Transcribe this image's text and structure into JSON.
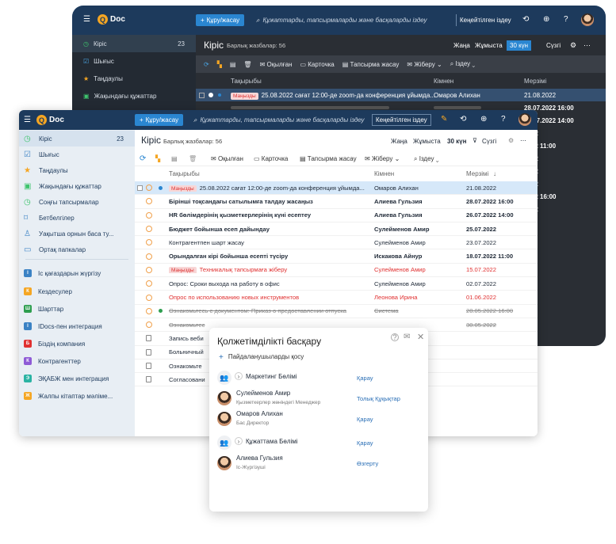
{
  "dark": {
    "logo": "Doc",
    "create": "Құру/жасау",
    "search_placeholder": "Құжаттарды, тапсырмаларды және басқаларды іздеу",
    "advanced": "Кеңейтілген іздеу",
    "sidebar": [
      {
        "label": "Кіріс",
        "count": "23",
        "icon": "clock-icon"
      },
      {
        "label": "Шығыс",
        "icon": "check-box-icon"
      },
      {
        "label": "Таңдаулы",
        "icon": "star-icon"
      },
      {
        "label": "Жақындағы құжаттар",
        "icon": "document-icon"
      }
    ],
    "title": "Кіріс",
    "subtitle": "Барлық жазбалар: 56",
    "filters": [
      "Жаңа",
      "Жұмыста",
      "30 күн",
      "Сүзгі"
    ],
    "toolbar": [
      "Оқылған",
      "Карточка",
      "Тапсырма жасау",
      "Жіберу",
      "Іздеу"
    ],
    "columns": [
      "Тақырыбы",
      "Кімнен",
      "Мерзімі"
    ],
    "rows": [
      {
        "tag": "Маңызды",
        "title": "25.08.2022 сағат 12:00-де zoom-да конференция ұйымда...",
        "from": "Омаров Алихан",
        "date": "21.08.2022"
      },
      {
        "tag": "",
        "title": "",
        "from": "",
        "date": "28.07.2022 16:00"
      },
      {
        "tag": "",
        "title": "",
        "from": "",
        "date": "26.07.2022 14:00"
      },
      {
        "tag": "",
        "title": "",
        "from": "",
        "date": "2022"
      },
      {
        "tag": "",
        "title": "",
        "from": "",
        "date": "2022 11:00"
      },
      {
        "tag": "",
        "title": "",
        "from": "",
        "date": "2022"
      },
      {
        "tag": "",
        "title": "",
        "from": "",
        "date": "2022"
      },
      {
        "tag": "",
        "title": "",
        "from": "",
        "date": "2022"
      },
      {
        "tag": "",
        "title": "",
        "from": "",
        "date": "2022 16:00"
      },
      {
        "tag": "",
        "title": "",
        "from": "",
        "date": "2022"
      }
    ]
  },
  "light": {
    "logo": "Doc",
    "create": "Құру/жасау",
    "search_placeholder": "Құжаттарды, тапсырмаларды және басқаларды іздеу",
    "advanced": "Кеңейтілген іздеу",
    "sidebar": [
      {
        "label": "Кіріс",
        "count": "23",
        "icon": "clock-icon"
      },
      {
        "label": "Шығыс",
        "icon": "check-box-icon"
      },
      {
        "label": "Таңдаулы",
        "icon": "star-icon"
      },
      {
        "label": "Жақындағы құжаттар",
        "icon": "document-icon"
      },
      {
        "label": "Соңғы тапсырмалар",
        "icon": "clock-icon"
      },
      {
        "label": "Бетбелгілер",
        "icon": "bookmark-icon"
      },
      {
        "label": "Уақытша орнын баса ту...",
        "icon": "user-icon"
      },
      {
        "label": "Ортақ папкалар",
        "icon": "folder-icon"
      },
      {
        "label": "Іс қағаздарын жүргізу",
        "letter": "І",
        "color": "#3b82c4"
      },
      {
        "label": "Кездесулер",
        "letter": "К",
        "color": "#f5a623"
      },
      {
        "label": "Шарттар",
        "letter": "Ш",
        "color": "#2e9e4f"
      },
      {
        "label": "IDocs-пен интеграция",
        "letter": "І",
        "color": "#3b82c4"
      },
      {
        "label": "Біздің компания",
        "letter": "Б",
        "color": "#e03131"
      },
      {
        "label": "Контрагенттер",
        "letter": "К",
        "color": "#8e5bd6"
      },
      {
        "label": "ЭҚАБЖ мен интеграция",
        "letter": "Э",
        "color": "#2bb3a3"
      },
      {
        "label": "Жалпы кітаптар мәліме...",
        "letter": "Ж",
        "color": "#f5a623"
      }
    ],
    "title": "Кіріс",
    "subtitle": "Барлық жазбалар: 56",
    "filters": [
      "Жаңа",
      "Жұмыста",
      "30 күн",
      "Сүзгі"
    ],
    "toolbar": [
      "Оқылған",
      "Карточка",
      "Тапсырма жасау",
      "Жіберу",
      "Іздеу"
    ],
    "columns": [
      "Тақырыбы",
      "Кімнен",
      "Мерзімі"
    ],
    "rows": [
      {
        "tag": "Маңызды",
        "title": "25.08.2022 сағат 12:00-де zoom-да конференция ұйымда...",
        "from": "Омаров Алихан",
        "date": "21.08.2022",
        "style": "sel",
        "icon": "clock"
      },
      {
        "tag": "",
        "title": "Бірінші тоқсандағы сатылымға талдау жасаңыз",
        "from": "Алиева Гульзия",
        "date": "28.07.2022 16:00",
        "style": "bold",
        "icon": "clock"
      },
      {
        "tag": "",
        "title": "HR бөлімдерінің қызметкерлерінің күні есептеу",
        "from": "Алиева Гульзия",
        "date": "26.07.2022 14:00",
        "style": "bold",
        "icon": "clock"
      },
      {
        "tag": "",
        "title": "Бюджет бойынша есеп дайындау",
        "from": "Сулейменов Амир",
        "date": "25.07.2022",
        "style": "bold",
        "icon": "clock"
      },
      {
        "tag": "",
        "title": "Контрагентпен шарт жасау",
        "from": "Сулейменов Амир",
        "date": "23.07.2022",
        "style": "",
        "icon": "clock"
      },
      {
        "tag": "",
        "title": "Орындалған кірі бойынша есепті түсіру",
        "from": "Искакова Айнур",
        "date": "18.07.2022 11:00",
        "style": "bold",
        "icon": "clock"
      },
      {
        "tag": "Маңызды",
        "title": "Техникалық тапсырмаға жіберу",
        "from": "Сулейменов Амир",
        "date": "15.07.2022",
        "style": "red",
        "icon": "clock"
      },
      {
        "tag": "",
        "title": "Опрос: Сроки выхода на работу в офис",
        "from": "Сулейменов Амир",
        "date": "02.07.2022",
        "style": "",
        "icon": "clock"
      },
      {
        "tag": "",
        "title": "Опрос по использованию новых инструментов",
        "from": "Леонова Ирина",
        "date": "01.06.2022",
        "style": "red",
        "icon": "clock"
      },
      {
        "tag": "",
        "title": "Ознакомьтесь с документом: Приказ о предоставлении отпуска",
        "from": "Система",
        "date": "28.05.2022 16:00",
        "style": "strike",
        "icon": "clock"
      },
      {
        "tag": "",
        "title": "Ознакомьтес",
        "from": "",
        "date": "30.05.2022",
        "style": "strike",
        "icon": "clock"
      },
      {
        "tag": "",
        "title": "Запись веби",
        "from": "",
        "date": "",
        "style": "",
        "icon": "doc"
      },
      {
        "tag": "",
        "title": "Больничный",
        "from": "",
        "date": "",
        "style": "",
        "icon": "doc"
      },
      {
        "tag": "",
        "title": "Ознакомьте",
        "from": "",
        "date": "",
        "style": "",
        "icon": "doc"
      },
      {
        "tag": "",
        "title": "Согласовани",
        "from": "",
        "date": "",
        "style": "",
        "icon": "doc"
      }
    ]
  },
  "popup": {
    "title": "Қолжетімділікті басқару",
    "add": "Пайдаланушыларды қосу",
    "entries": [
      {
        "name": "Маркетинг Бөлімі",
        "role": "",
        "access": "Қарау",
        "type": "group"
      },
      {
        "name": "Сулейменов Амир",
        "role": "Қызметкерлер жөніндегі Менеджер",
        "access": "Толық Құқықтар",
        "type": "person"
      },
      {
        "name": "Омаров Алихан",
        "role": "Бас Директор",
        "access": "Қарау",
        "type": "person"
      },
      {
        "name": "Құжаттама Бөлімі",
        "role": "",
        "access": "Қарау",
        "type": "group"
      },
      {
        "name": "Алиева Гульзия",
        "role": "Іс-Жүргізуші",
        "access": "Өзгерту",
        "type": "person"
      }
    ]
  },
  "colors": {
    "header": "#1d3a5c",
    "accent": "#2a86d1",
    "important": "#e03131",
    "logo": "#f5a623"
  }
}
